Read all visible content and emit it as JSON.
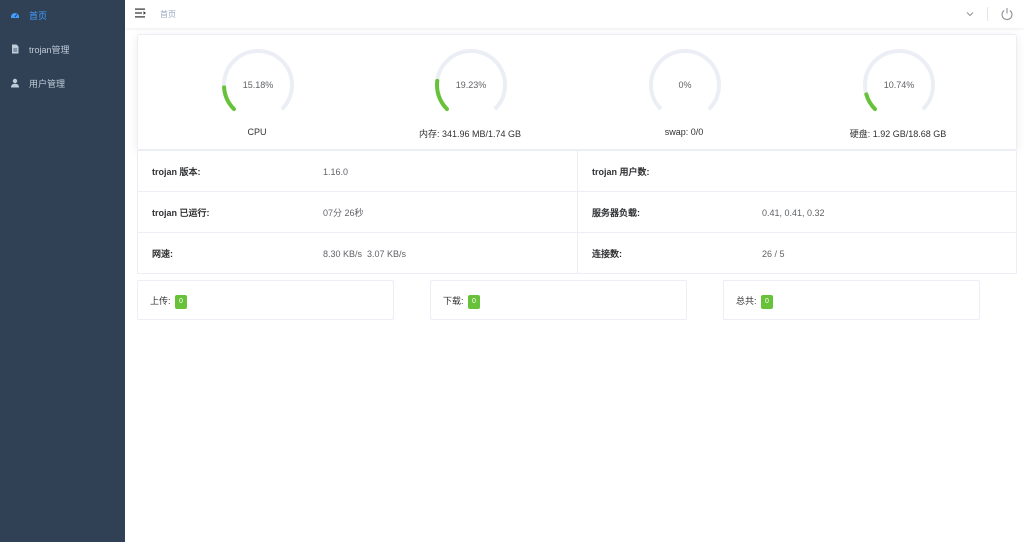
{
  "sidebar": {
    "items": [
      {
        "label": "首页",
        "icon": "dashboard-icon",
        "active": true
      },
      {
        "label": "trojan管理",
        "icon": "document-icon",
        "active": false
      },
      {
        "label": "用户管理",
        "icon": "user-icon",
        "active": false
      }
    ]
  },
  "navbar": {
    "breadcrumb": "首页"
  },
  "gauges": [
    {
      "name": "cpu",
      "value_text": "15.18%",
      "value": 15.18,
      "label": "CPU"
    },
    {
      "name": "memory",
      "value_text": "19.23%",
      "value": 19.23,
      "label": "内存: 341.96 MB/1.74 GB"
    },
    {
      "name": "swap",
      "value_text": "0%",
      "value": 0,
      "label": "swap: 0/0"
    },
    {
      "name": "disk",
      "value_text": "10.74%",
      "value": 10.74,
      "label": "硬盘: 1.92 GB/18.68 GB"
    }
  ],
  "info": {
    "version_label": "trojan 版本:",
    "version_value": "1.16.0",
    "users_label": "trojan 用户数:",
    "users_value": "",
    "uptime_label": "trojan 已运行:",
    "uptime_value": "07分 26秒",
    "load_label": "服务器负载:",
    "load_value": "0.41, 0.41, 0.32",
    "speed_label": "网速:",
    "speed_value": "8.30 KB/s  3.07 KB/s",
    "conn_label": "连接数:",
    "conn_value": "26 / 5"
  },
  "traffic": {
    "upload_label": "上传:",
    "upload_value": "0",
    "download_label": "下载:",
    "download_value": "0",
    "total_label": "总共:",
    "total_value": "0"
  },
  "colors": {
    "sidebar_bg": "#304156",
    "active": "#409eff",
    "gauge_progress": "#67c23a",
    "gauge_track": "#ebeef5",
    "badge": "#67c23a"
  }
}
